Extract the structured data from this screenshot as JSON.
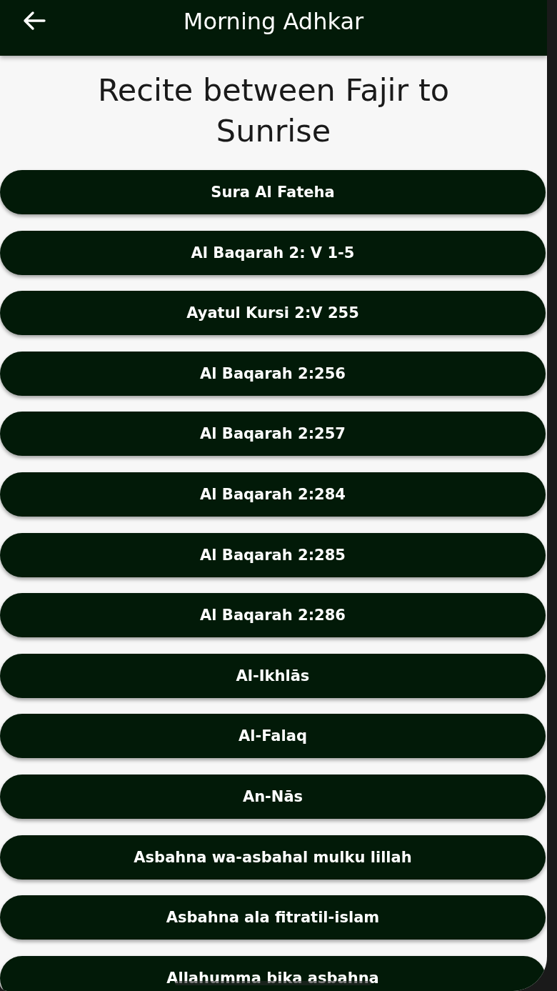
{
  "app_bar": {
    "title": "Morning Adhkar"
  },
  "heading": "Recite between Fajir to Sunrise",
  "items": [
    {
      "label": "Sura Al Fateha"
    },
    {
      "label": "Al Baqarah 2: V 1-5"
    },
    {
      "label": "Ayatul Kursi 2:V 255"
    },
    {
      "label": "Al Baqarah 2:256"
    },
    {
      "label": "Al Baqarah 2:257"
    },
    {
      "label": "Al Baqarah 2:284"
    },
    {
      "label": "Al Baqarah 2:285"
    },
    {
      "label": "Al Baqarah 2:286"
    },
    {
      "label": "Al-Ikhlās"
    },
    {
      "label": "Al-Falaq"
    },
    {
      "label": "An-Nās"
    },
    {
      "label": "Asbahna wa-asbahal mulku lillah"
    },
    {
      "label": "Asbahna ala fitratil-islam"
    },
    {
      "label": "Allahumma bika asbahna"
    }
  ]
}
